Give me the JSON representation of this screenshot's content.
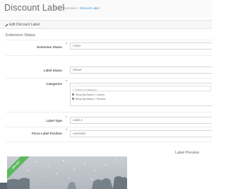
{
  "header": {
    "title": "Discount Label",
    "breadcrumb": [
      "Home",
      "Extension",
      "Discount Label"
    ]
  },
  "panel": {
    "heading": "Edit Discount Label",
    "icon": "pencil-icon"
  },
  "section": {
    "title": "Extension Status"
  },
  "fields": {
    "extension_status": {
      "label": "Extension Status",
      "value": "Active"
    },
    "label_status": {
      "label": "Label Status",
      "value": "Shown"
    },
    "categories": {
      "label": "Categories",
      "placeholder": "Select a category",
      "selected": [
        "Shop By Brand > Canon",
        "Shop By Brand > Pioneer"
      ]
    },
    "label_type": {
      "label": "Label Type",
      "value": "Label 2"
    },
    "force_label_position": {
      "label": "Force Label Position",
      "value": "Automatic"
    }
  },
  "preview": {
    "title": "Label Preview",
    "ribbon_text": "10% OFF"
  },
  "colors": {
    "accent": "#3b8fd6",
    "required": "#e03a3a",
    "ribbon": "#5cb85c"
  }
}
